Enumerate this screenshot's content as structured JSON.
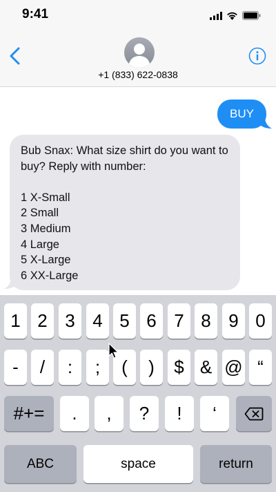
{
  "status": {
    "time": "9:41",
    "icons": [
      "cellular-signal-icon",
      "wifi-icon",
      "battery-icon"
    ]
  },
  "header": {
    "contact_number": "+1 (833) 622-0838",
    "back_icon": "chevron-left-icon",
    "info_icon": "info-icon",
    "accent_color": "#1e8ef5"
  },
  "messages": [
    {
      "direction": "outgoing",
      "text": "BUY"
    },
    {
      "direction": "incoming",
      "text": "Bub Snax: What size shirt do you want to buy? Reply with number:\n\n1 X-Small\n2 Small\n3 Medium\n4 Large\n5 X-Large\n6 XX-Large"
    }
  ],
  "keyboard": {
    "row1": [
      "1",
      "2",
      "3",
      "4",
      "5",
      "6",
      "7",
      "8",
      "9",
      "0"
    ],
    "row2": [
      "-",
      "/",
      ":",
      ";",
      "(",
      ")",
      "$",
      "&",
      "@",
      "“"
    ],
    "row3": {
      "toggle": "#+=",
      "keys": [
        ".",
        ",",
        "?",
        "!",
        "‘"
      ],
      "delete_icon": "backspace-icon"
    },
    "row4": {
      "abc": "ABC",
      "space": "space",
      "return": "return"
    }
  }
}
